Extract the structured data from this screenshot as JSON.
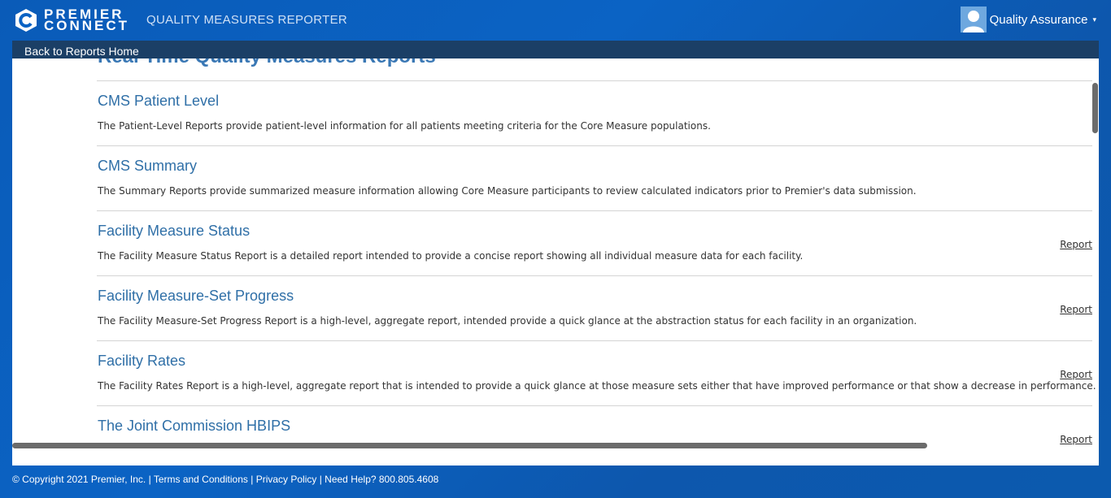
{
  "header": {
    "logo_line1": "PREMIER",
    "logo_line2": "CONNECT",
    "app_title": "QUALITY MEASURES REPORTER",
    "user_name": "Quality Assurance",
    "caret": "▾"
  },
  "nav": {
    "back_label": "Back to Reports Home"
  },
  "page": {
    "title": "Real Time Quality Measures Reports"
  },
  "reports": [
    {
      "title": "CMS Patient Level",
      "description": "The Patient-Level Reports provide patient-level information for all patients meeting criteria for the Core Measure populations.",
      "link": ""
    },
    {
      "title": "CMS Summary",
      "description": "The Summary Reports provide summarized measure information allowing Core Measure participants to review calculated indicators prior to Premier's data submission.",
      "link": ""
    },
    {
      "title": "Facility Measure Status",
      "description": "The Facility Measure Status Report is a detailed report intended to provide a concise report showing all individual measure data for each facility.",
      "link": "Report"
    },
    {
      "title": "Facility Measure-Set Progress",
      "description": "The Facility Measure-Set Progress Report is a high-level, aggregate report, intended provide a quick glance at the abstraction status for each facility in an organization.",
      "link": "Report"
    },
    {
      "title": "Facility Rates",
      "description": "The Facility Rates Report is a high-level, aggregate report that is intended to provide a quick glance at those measure sets either that have improved performance or that show a decrease in performance.",
      "link": "Report"
    },
    {
      "title": "The Joint Commission HBIPS",
      "description": "",
      "link": "Report"
    }
  ],
  "footer": {
    "copyright": "© Copyright 2021 Premier, Inc.",
    "sep1": " | ",
    "terms": "Terms and Conditions",
    "sep2": " | ",
    "privacy": "Privacy Policy",
    "sep3": " | ",
    "help": "Need Help? 800.805.4608"
  },
  "colors": {
    "header_bg": "#0b63c4",
    "backbar": "#1b3f66",
    "link_blue": "#2f6fa7"
  }
}
